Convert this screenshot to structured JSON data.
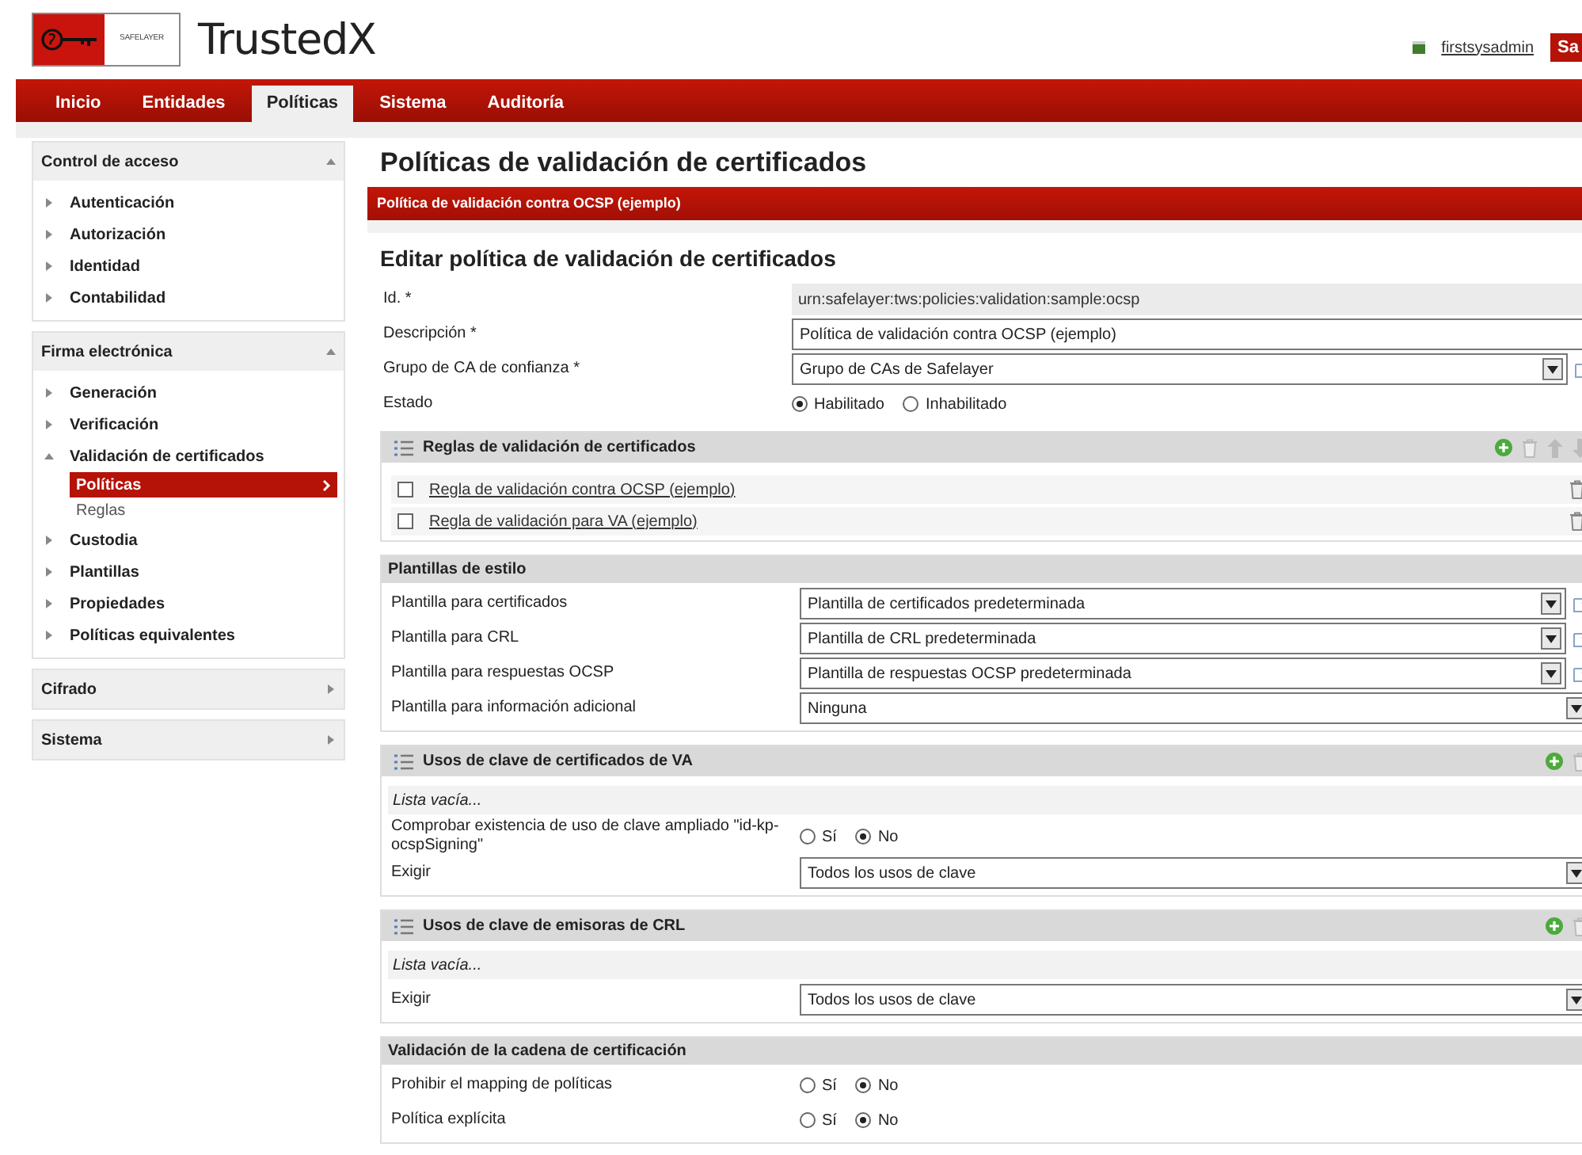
{
  "header": {
    "logo_text": "SAFELAYER",
    "app_name": "TrustedX",
    "user": "firstsysadmin",
    "button": "Sa"
  },
  "nav": [
    {
      "label": "Inicio",
      "selected": false
    },
    {
      "label": "Entidades",
      "selected": false
    },
    {
      "label": "Políticas",
      "selected": true
    },
    {
      "label": "Sistema",
      "selected": false
    },
    {
      "label": "Auditoría",
      "selected": false
    }
  ],
  "sidebar": [
    {
      "title": "Control de acceso",
      "expanded": true,
      "items": [
        {
          "label": "Autenticación",
          "expanded": false
        },
        {
          "label": "Autorización",
          "expanded": false
        },
        {
          "label": "Identidad",
          "expanded": false
        },
        {
          "label": "Contabilidad",
          "expanded": false
        }
      ]
    },
    {
      "title": "Firma electrónica",
      "expanded": true,
      "items": [
        {
          "label": "Generación",
          "expanded": false
        },
        {
          "label": "Verificación",
          "expanded": false
        },
        {
          "label": "Validación de certificados",
          "expanded": true,
          "children": [
            {
              "label": "Políticas",
              "selected": true
            },
            {
              "label": "Reglas",
              "selected": false
            }
          ]
        },
        {
          "label": "Custodia",
          "expanded": false
        },
        {
          "label": "Plantillas",
          "expanded": false
        },
        {
          "label": "Propiedades",
          "expanded": false
        },
        {
          "label": "Políticas equivalentes",
          "expanded": false
        }
      ]
    },
    {
      "title": "Cifrado",
      "expanded": false
    },
    {
      "title": "Sistema",
      "expanded": false
    }
  ],
  "main": {
    "title": "Políticas de validación de certificados",
    "record_tab": "Política de validación contra OCSP (ejemplo)",
    "form_title": "Editar política de validación de certificados",
    "fields": [
      {
        "kind": "readonly",
        "label": "Id. *",
        "value": "urn:safelayer:tws:policies:validation:sample:ocsp"
      },
      {
        "kind": "text",
        "label": "Descripción *",
        "value": "Política de validación contra OCSP (ejemplo)"
      },
      {
        "kind": "select",
        "label": "Grupo de CA de confianza *",
        "value": "Grupo de CAs de Safelayer",
        "edit_link": true
      },
      {
        "kind": "radio",
        "label": "Estado",
        "options": [
          {
            "label": "Habilitado",
            "selected": true
          },
          {
            "label": "Inhabilitado",
            "selected": false
          }
        ]
      }
    ],
    "sections": [
      {
        "kind": "list",
        "title": "Reglas de validación de certificados",
        "reorderable": true,
        "rows": [
          {
            "label": "Regla de validación contra OCSP (ejemplo)",
            "checked": false
          },
          {
            "label": "Regla de validación para VA (ejemplo)",
            "checked": false
          }
        ]
      },
      {
        "kind": "group",
        "title": "Plantillas de estilo",
        "fields": [
          {
            "kind": "select",
            "label": "Plantilla para certificados",
            "value": "Plantilla de certificados predeterminada",
            "edit_link": true
          },
          {
            "kind": "select",
            "label": "Plantilla para CRL",
            "value": "Plantilla de CRL predeterminada",
            "edit_link": true
          },
          {
            "kind": "select",
            "label": "Plantilla para respuestas OCSP",
            "value": "Plantilla de respuestas OCSP predeterminada",
            "edit_link": true
          },
          {
            "kind": "select",
            "label": "Plantilla para información adicional",
            "value": "Ninguna",
            "edit_link": false
          }
        ]
      },
      {
        "kind": "list",
        "title": "Usos de clave de certificados de VA",
        "reorderable": false,
        "empty": "Lista vacía...",
        "fields": [
          {
            "kind": "radio",
            "label": "Comprobar existencia de uso de clave ampliado \"id-kp-ocspSigning\"",
            "options": [
              {
                "label": "Sí",
                "selected": false
              },
              {
                "label": "No",
                "selected": true
              }
            ]
          },
          {
            "kind": "select",
            "label": "Exigir",
            "value": "Todos los usos de clave",
            "edit_link": false
          }
        ]
      },
      {
        "kind": "list",
        "title": "Usos de clave de emisoras de CRL",
        "reorderable": false,
        "empty": "Lista vacía...",
        "fields": [
          {
            "kind": "select",
            "label": "Exigir",
            "value": "Todos los usos de clave",
            "edit_link": false
          }
        ]
      },
      {
        "kind": "group",
        "title": "Validación de la cadena de certificación",
        "fields": [
          {
            "kind": "radio",
            "label": "Prohibir el mapping de políticas",
            "options": [
              {
                "label": "Sí",
                "selected": false
              },
              {
                "label": "No",
                "selected": true
              }
            ]
          },
          {
            "kind": "radio",
            "label": "Política explícita",
            "options": [
              {
                "label": "Sí",
                "selected": false
              },
              {
                "label": "No",
                "selected": true
              }
            ]
          }
        ]
      }
    ]
  }
}
